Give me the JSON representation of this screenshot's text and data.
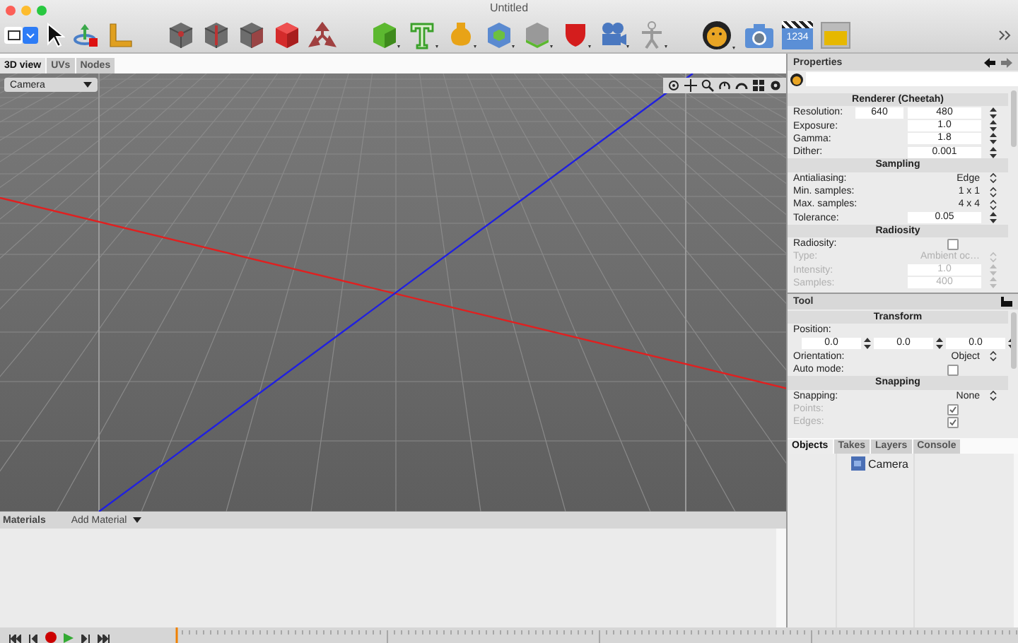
{
  "window": {
    "title": "Untitled"
  },
  "toolbar": {
    "clapboard_number": "1234"
  },
  "view_tabs": [
    {
      "label": "3D view",
      "selected": true
    },
    {
      "label": "UVs",
      "selected": false
    },
    {
      "label": "Nodes",
      "selected": false
    }
  ],
  "camera_menu": {
    "value": "Camera"
  },
  "materials": {
    "title": "Materials",
    "add_button": "Add Material"
  },
  "properties": {
    "title": "Properties",
    "sections": [
      {
        "heading": "Renderer (Cheetah)",
        "rows": [
          {
            "kind": "pair",
            "label": "Resolution:",
            "values": [
              "640",
              "480"
            ],
            "disabled": false
          },
          {
            "kind": "number",
            "label": "Exposure:",
            "value": "1.0",
            "disabled": false
          },
          {
            "kind": "number",
            "label": "Gamma:",
            "value": "1.8",
            "disabled": false
          },
          {
            "kind": "number",
            "label": "Dither:",
            "value": "0.001",
            "disabled": false
          }
        ]
      },
      {
        "heading": "Sampling",
        "rows": [
          {
            "kind": "choice",
            "label": "Antialiasing:",
            "value": "Edge",
            "disabled": false
          },
          {
            "kind": "choice",
            "label": "Min. samples:",
            "value": "1 x 1",
            "disabled": false
          },
          {
            "kind": "choice",
            "label": "Max. samples:",
            "value": "4 x 4",
            "disabled": false
          },
          {
            "kind": "number",
            "label": "Tolerance:",
            "value": "0.05",
            "disabled": false
          }
        ]
      },
      {
        "heading": "Radiosity",
        "rows": [
          {
            "kind": "check",
            "label": "Radiosity:",
            "checked": false,
            "disabled": false
          },
          {
            "kind": "choice",
            "label": "Type:",
            "value": "Ambient oc…",
            "disabled": true
          },
          {
            "kind": "number",
            "label": "Intensity:",
            "value": "1.0",
            "disabled": true
          },
          {
            "kind": "number",
            "label": "Samples:",
            "value": "400",
            "disabled": true
          }
        ]
      }
    ]
  },
  "tool": {
    "title": "Tool",
    "sections": [
      {
        "heading": "Transform",
        "rows": [
          {
            "kind": "label",
            "label": "Position:",
            "disabled": false
          },
          {
            "kind": "triple",
            "values": [
              "0.0",
              "0.0",
              "0.0"
            ],
            "disabled": false
          },
          {
            "kind": "choice",
            "label": "Orientation:",
            "value": "Object",
            "disabled": false
          },
          {
            "kind": "check",
            "label": "Auto mode:",
            "checked": false,
            "disabled": false
          }
        ]
      },
      {
        "heading": "Snapping",
        "rows": [
          {
            "kind": "choice",
            "label": "Snapping:",
            "value": "None",
            "disabled": false
          },
          {
            "kind": "check",
            "label": "Points:",
            "checked": true,
            "disabled": true
          },
          {
            "kind": "check",
            "label": "Edges:",
            "checked": true,
            "disabled": true
          }
        ]
      }
    ]
  },
  "panel_tabs": [
    {
      "label": "Objects",
      "selected": true
    },
    {
      "label": "Takes",
      "selected": false
    },
    {
      "label": "Layers",
      "selected": false
    },
    {
      "label": "Console",
      "selected": false
    }
  ],
  "objects": [
    {
      "label": "Camera"
    }
  ]
}
